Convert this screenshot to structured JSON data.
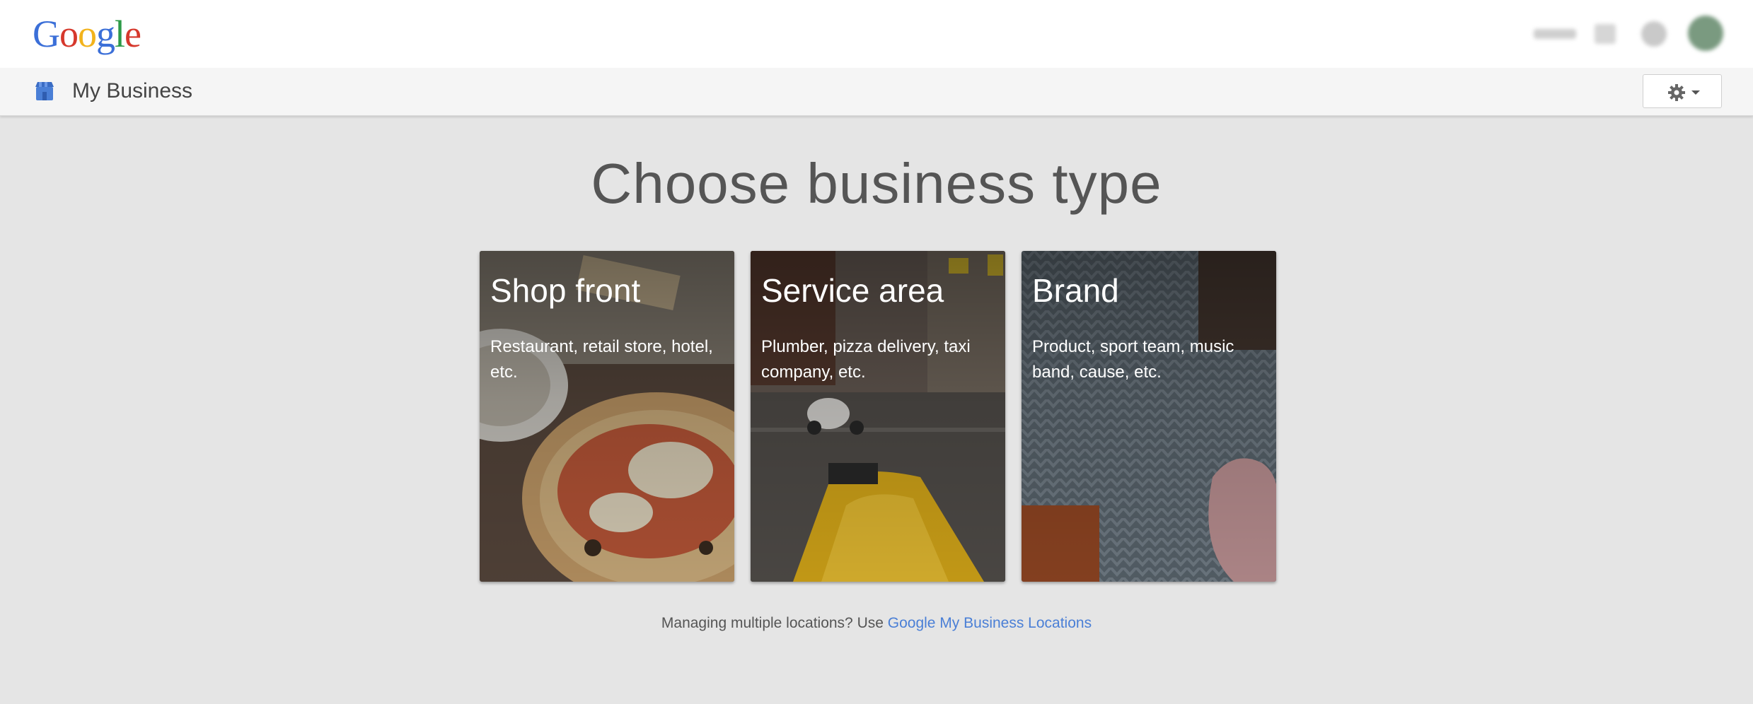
{
  "topbar": {
    "logo_letters": [
      {
        "char": "G",
        "color": "#3b6fd8"
      },
      {
        "char": "o",
        "color": "#d6382c"
      },
      {
        "char": "o",
        "color": "#f2b31c"
      },
      {
        "char": "g",
        "color": "#3b6fd8"
      },
      {
        "char": "l",
        "color": "#2d9a48"
      },
      {
        "char": "e",
        "color": "#d6382c"
      }
    ]
  },
  "subbar": {
    "title": "My Business",
    "icon": "store-icon",
    "settings_icon": "gear-icon"
  },
  "main": {
    "heading": "Choose business type",
    "cards": [
      {
        "title": "Shop front",
        "description": "Restaurant, retail store, hotel, etc."
      },
      {
        "title": "Service area",
        "description": "Plumber, pizza delivery, taxi company, etc."
      },
      {
        "title": "Brand",
        "description": "Product, sport team, music band, cause, etc."
      }
    ],
    "footer_text": "Managing multiple locations? Use ",
    "footer_link": "Google My Business Locations"
  },
  "colors": {
    "background": "#e5e5e5",
    "link": "#4a7fd6",
    "brand_blue": "#4a7fd6"
  }
}
